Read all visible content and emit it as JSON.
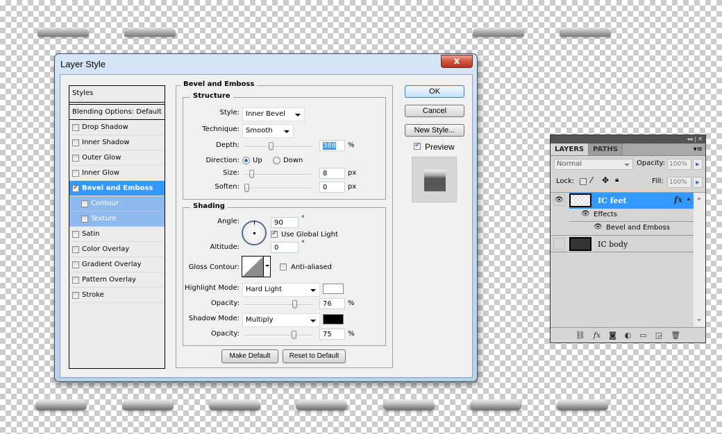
{
  "dialog": {
    "title": "Layer Style",
    "close_label": "x",
    "styles_header": "Styles",
    "blending_options": "Blending Options: Default",
    "effects": [
      {
        "label": "Drop Shadow",
        "checked": false,
        "state": "normal"
      },
      {
        "label": "Inner Shadow",
        "checked": false,
        "state": "normal"
      },
      {
        "label": "Outer Glow",
        "checked": false,
        "state": "normal"
      },
      {
        "label": "Inner Glow",
        "checked": false,
        "state": "normal"
      },
      {
        "label": "Bevel and Emboss",
        "checked": true,
        "state": "selected"
      },
      {
        "label": "Contour",
        "checked": false,
        "state": "sub"
      },
      {
        "label": "Texture",
        "checked": false,
        "state": "sub"
      },
      {
        "label": "Satin",
        "checked": false,
        "state": "normal"
      },
      {
        "label": "Color Overlay",
        "checked": false,
        "state": "normal"
      },
      {
        "label": "Gradient Overlay",
        "checked": false,
        "state": "normal"
      },
      {
        "label": "Pattern Overlay",
        "checked": false,
        "state": "normal"
      },
      {
        "label": "Stroke",
        "checked": false,
        "state": "normal"
      }
    ],
    "section_title": "Bevel and Emboss",
    "structure": {
      "legend": "Structure",
      "style_label": "Style:",
      "style_value": "Inner Bevel",
      "technique_label": "Technique:",
      "technique_value": "Smooth",
      "depth_label": "Depth:",
      "depth_value": "388",
      "depth_unit": "%",
      "depth_slider": 0.39,
      "direction_label": "Direction:",
      "direction_up": "Up",
      "direction_down": "Down",
      "direction_selected": "Up",
      "size_label": "Size:",
      "size_value": "8",
      "size_unit": "px",
      "size_slider": 0.08,
      "soften_label": "Soften:",
      "soften_value": "0",
      "soften_unit": "px",
      "soften_slider": 0.0
    },
    "shading": {
      "legend": "Shading",
      "angle_label": "Angle:",
      "angle_value": "90",
      "angle_unit": "°",
      "global_light_label": "Use Global Light",
      "global_light_checked": true,
      "altitude_label": "Altitude:",
      "altitude_value": "0",
      "altitude_unit": "°",
      "gloss_label": "Gloss Contour:",
      "anti_aliased_label": "Anti-aliased",
      "anti_aliased_checked": false,
      "highlight_mode_label": "Highlight Mode:",
      "highlight_mode_value": "Hard Light",
      "highlight_color": "#ffffff",
      "highlight_opacity_label": "Opacity:",
      "highlight_opacity_value": "76",
      "highlight_opacity_unit": "%",
      "highlight_opacity_slider": 0.76,
      "shadow_mode_label": "Shadow Mode:",
      "shadow_mode_value": "Multiply",
      "shadow_color": "#000000",
      "shadow_opacity_label": "Opacity:",
      "shadow_opacity_value": "75",
      "shadow_opacity_unit": "%",
      "shadow_opacity_slider": 0.75
    },
    "make_default": "Make Default",
    "reset_default": "Reset to Default",
    "ok": "OK",
    "cancel": "Cancel",
    "new_style": "New Style...",
    "preview_label": "Preview",
    "preview_checked": true
  },
  "layers_panel": {
    "topbar": "◂◂ | ✕",
    "tabs": [
      "LAYERS",
      "PATHS"
    ],
    "blend_mode": "Normal",
    "opacity_label": "Opacity:",
    "opacity_value": "100%",
    "lock_label": "Lock:",
    "fill_label": "Fill:",
    "fill_value": "100%",
    "layers": [
      {
        "name": "IC feet",
        "selected": true,
        "visible": true,
        "fx": "fx"
      },
      {
        "name": "Effects",
        "type": "effects-group"
      },
      {
        "name": "Bevel and Emboss",
        "type": "effect"
      },
      {
        "name": "IC body",
        "selected": false,
        "visible": false
      }
    ]
  }
}
